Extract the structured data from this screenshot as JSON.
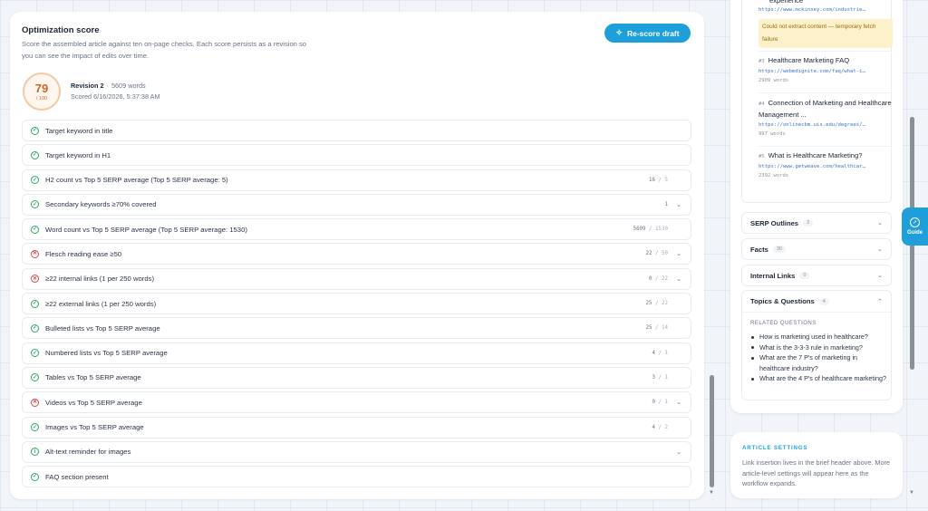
{
  "optimization": {
    "title": "Optimization score",
    "description": "Score the assembled article against ten on-page checks. Each score persists as a revision so you can see the impact of edits over time.",
    "rescore_label": "Re-score draft",
    "score": "79",
    "score_max": "/ 100",
    "revision": "Revision 2",
    "words": "5609 words",
    "scored_at": "Scored 6/16/2026, 5:37:38 AM"
  },
  "checks": [
    {
      "label": "Target keyword in title",
      "status": "pass",
      "value": "",
      "of": "",
      "expandable": false
    },
    {
      "label": "Target keyword in H1",
      "status": "pass",
      "value": "",
      "of": "",
      "expandable": false
    },
    {
      "label": "H2 count vs Top 5 SERP average (Top 5 SERP average: 5)",
      "status": "pass",
      "value": "16",
      "of": "/ 5",
      "expandable": false
    },
    {
      "label": "Secondary keywords ≥70% covered",
      "status": "pass",
      "value": "1",
      "of": "",
      "expandable": true
    },
    {
      "label": "Word count vs Top 5 SERP average (Top 5 SERP average: 1530)",
      "status": "pass",
      "value": "5609",
      "of": "/ 1530",
      "expandable": false
    },
    {
      "label": "Flesch reading ease ≥50",
      "status": "fail",
      "value": "22",
      "of": "/ 50",
      "expandable": true
    },
    {
      "label": "≥22 internal links (1 per 250 words)",
      "status": "fail",
      "value": "0",
      "of": "/ 22",
      "expandable": true
    },
    {
      "label": "≥22 external links (1 per 250 words)",
      "status": "pass",
      "value": "25",
      "of": "/ 22",
      "expandable": false
    },
    {
      "label": "Bulleted lists vs Top 5 SERP average",
      "status": "pass",
      "value": "25",
      "of": "/ 14",
      "expandable": false
    },
    {
      "label": "Numbered lists vs Top 5 SERP average",
      "status": "pass",
      "value": "4",
      "of": "/ 1",
      "expandable": false
    },
    {
      "label": "Tables vs Top 5 SERP average",
      "status": "pass",
      "value": "3",
      "of": "/ 1",
      "expandable": false
    },
    {
      "label": "Videos vs Top 5 SERP average",
      "status": "fail",
      "value": "0",
      "of": "/ 1",
      "expandable": true
    },
    {
      "label": "Images vs Top 5 SERP average",
      "status": "pass",
      "value": "4",
      "of": "/ 2",
      "expandable": false
    },
    {
      "label": "Alt-text reminder for images",
      "status": "info",
      "value": "",
      "of": "",
      "expandable": true
    },
    {
      "label": "FAQ section present",
      "status": "pass",
      "value": "",
      "of": "",
      "expandable": false
    }
  ],
  "sources": [
    {
      "title_partial": "experience",
      "url": "https://www.mckinsey.com/industrie…",
      "warning": "Could not extract content — temporary fetch failure"
    },
    {
      "num": "#3",
      "title": "Healthcare Marketing FAQ",
      "url": "https://webmdignite.com/faq/what-i…",
      "words": "2909 words"
    },
    {
      "num": "#4",
      "title": "Connection of Marketing and Healthcare Management ...",
      "url": "https://onlinecbm.uis.edu/degrees/…",
      "words": "997 words"
    },
    {
      "num": "#5",
      "title": "What is Healthcare Marketing?",
      "url": "https://www.getweave.com/healthcar…",
      "words": "2392 words"
    }
  ],
  "accordions": {
    "serp": {
      "label": "SERP Outlines",
      "count": "3"
    },
    "facts": {
      "label": "Facts",
      "count": "30"
    },
    "internal": {
      "label": "Internal Links",
      "count": "0"
    },
    "topics": {
      "label": "Topics & Questions",
      "count": "4"
    }
  },
  "related_questions": {
    "title": "RELATED QUESTIONS",
    "items": [
      "How is marketing used in healthcare?",
      "What is the 3-3-3 rule in marketing?",
      "What are the 7 P's of marketing in healthcare industry?",
      "What are the 4 P's of healthcare marketing?"
    ]
  },
  "guide": {
    "label": "Guide"
  },
  "article_settings": {
    "title": "ARTICLE SETTINGS",
    "text": "Link insertion lives in the brief header above. More article-level settings will appear here as the workflow expands."
  },
  "colors": {
    "accent": "#1f9fd9",
    "pass": "#2fa66b",
    "fail": "#dc4b4b",
    "score": "#c8661f",
    "link": "#3b73c7"
  }
}
